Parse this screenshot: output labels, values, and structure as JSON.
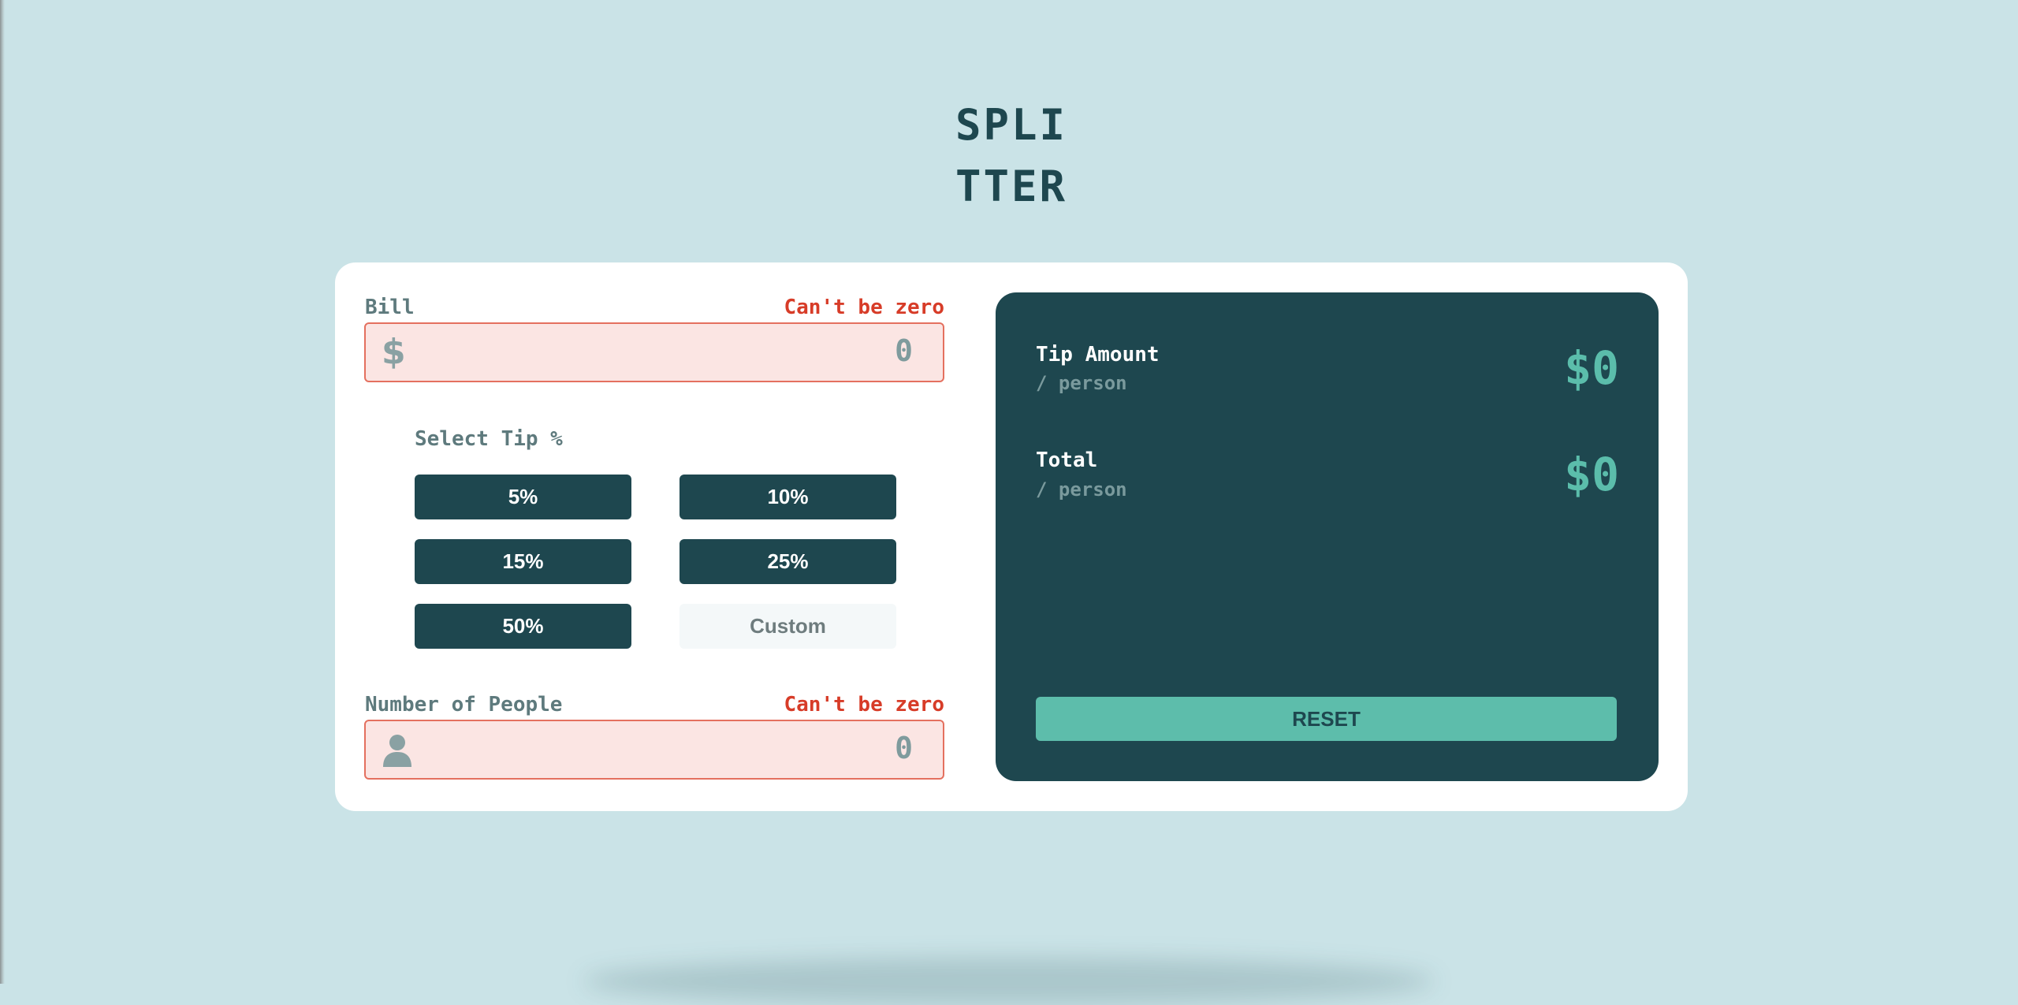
{
  "app": {
    "logo_line1": "SPLI",
    "logo_line2": "TTER"
  },
  "form": {
    "bill": {
      "label": "Bill",
      "error": "Can't be zero",
      "icon": "dollar-icon",
      "icon_glyph": "$",
      "value": "0"
    },
    "tip": {
      "label": "Select Tip %",
      "options": [
        "5%",
        "10%",
        "15%",
        "25%",
        "50%"
      ],
      "custom_placeholder": "Custom"
    },
    "people": {
      "label": "Number of People",
      "error": "Can't be zero",
      "icon": "person-icon",
      "value": "0"
    }
  },
  "results": {
    "tip_amount": {
      "label": "Tip Amount",
      "sub": "/ person",
      "value": "$0"
    },
    "total": {
      "label": "Total",
      "sub": "/ person",
      "value": "$0"
    },
    "reset_label": "RESET"
  },
  "colors": {
    "background": "#cae3e7",
    "dark_teal": "#1e474f",
    "accent": "#5dbdab",
    "error": "#d73c28"
  }
}
